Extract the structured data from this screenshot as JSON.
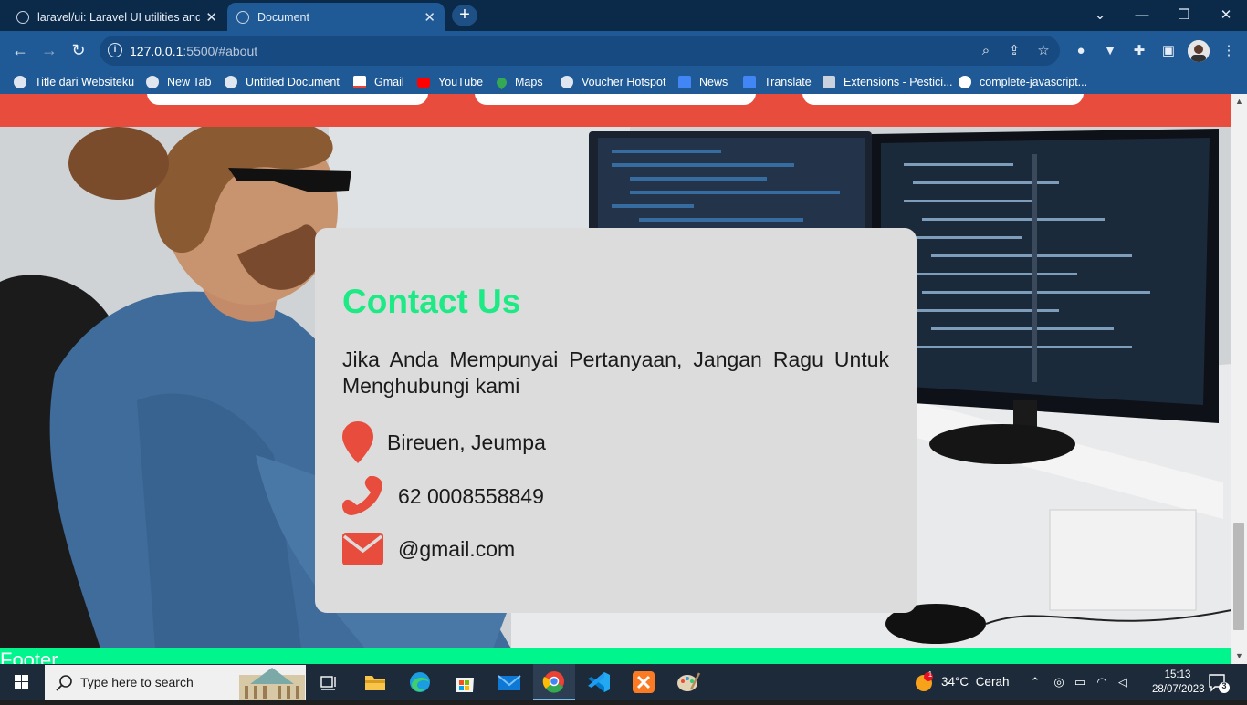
{
  "browser": {
    "tabs": [
      {
        "title": "laravel/ui: Laravel UI utilities and",
        "active": false,
        "icon": "github-icon"
      },
      {
        "title": "Document",
        "active": true,
        "icon": "globe-icon"
      }
    ],
    "new_tab": "+",
    "window_controls": {
      "minimize": "—",
      "restore": "❐",
      "close": "✕",
      "tab_search": "⌄"
    },
    "url_host": "127.0.0.1",
    "url_rest": ":5500/#about",
    "bookmarks": [
      {
        "label": "Title dari Websiteku",
        "icon": "globe-icon"
      },
      {
        "label": "New Tab",
        "icon": "globe-icon"
      },
      {
        "label": "Untitled Document",
        "icon": "globe-icon"
      },
      {
        "label": "Gmail",
        "icon": "gmail-icon"
      },
      {
        "label": "YouTube",
        "icon": "youtube-icon"
      },
      {
        "label": "Maps",
        "icon": "maps-icon"
      },
      {
        "label": "Voucher Hotspot",
        "icon": "globe-icon"
      },
      {
        "label": "News",
        "icon": "news-icon"
      },
      {
        "label": "Translate",
        "icon": "translate-icon"
      },
      {
        "label": "Extensions - Pestici...",
        "icon": "puzzle-icon"
      },
      {
        "label": "complete-javascript...",
        "icon": "github-icon"
      }
    ]
  },
  "page": {
    "contact": {
      "title": "Contact Us",
      "message": "Jika Anda Mempunyai Pertanyaan, Jangan Ragu Untuk Menghubungi kami",
      "address": "Bireuen, Jeumpa",
      "phone": "62 0008558849",
      "email": "@gmail.com"
    },
    "footer": "Footer",
    "colors": {
      "accent_green": "#1de985",
      "accent_red": "#e74c3c",
      "footer_green": "#00f58d"
    }
  },
  "taskbar": {
    "search_placeholder": "Type here to search",
    "weather_temp": "34°C",
    "weather_text": "Cerah",
    "weather_badge": "1",
    "time": "15:13",
    "date": "28/07/2023",
    "notifications": "3"
  }
}
